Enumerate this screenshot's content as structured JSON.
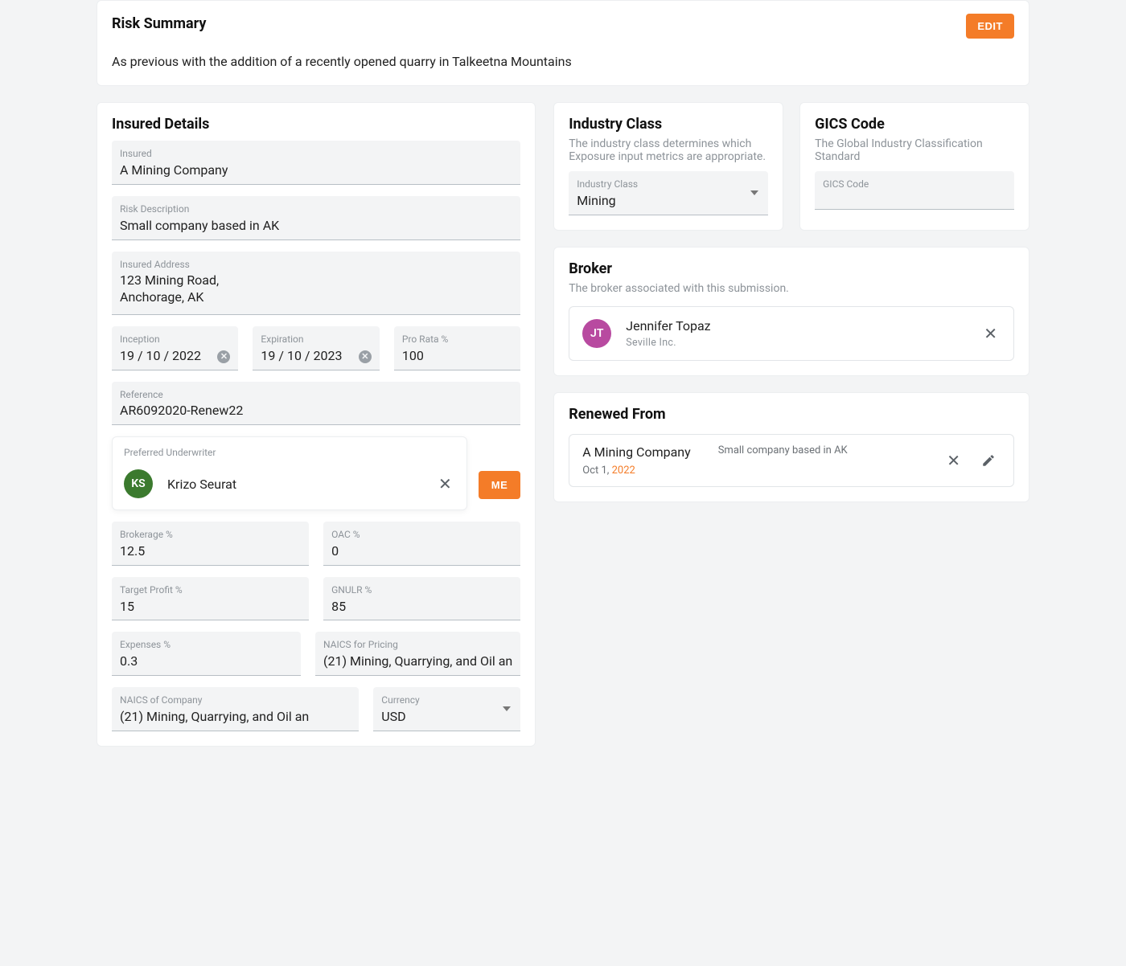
{
  "risk_summary": {
    "title": "Risk Summary",
    "edit_label": "EDIT",
    "body": "As previous with the addition of a recently opened quarry in Talkeetna Mountains"
  },
  "insured_details": {
    "title": "Insured Details",
    "insured_label": "Insured",
    "insured_value": "A Mining Company",
    "risk_desc_label": "Risk Description",
    "risk_desc_value": "Small company based in AK",
    "address_label": "Insured Address",
    "address_value": "123 Mining Road,\nAnchorage, AK",
    "inception_label": "Inception",
    "inception_value": "19 / 10 / 2022",
    "expiration_label": "Expiration",
    "expiration_value": "19 / 10 / 2023",
    "prorata_label": "Pro Rata %",
    "prorata_value": "100",
    "reference_label": "Reference",
    "reference_value": "AR6092020-Renew22",
    "underwriter_label": "Preferred Underwriter",
    "underwriter_initials": "KS",
    "underwriter_name": "Krizo Seurat",
    "me_label": "ME",
    "brokerage_label": "Brokerage %",
    "brokerage_value": "12.5",
    "oac_label": "OAC %",
    "oac_value": "0",
    "target_profit_label": "Target Profit %",
    "target_profit_value": "15",
    "gnulr_label": "GNULR %",
    "gnulr_value": "85",
    "expenses_label": "Expenses %",
    "expenses_value": "0.3",
    "naics_pricing_label": "NAICS for Pricing",
    "naics_pricing_value": "(21) Mining, Quarrying, and Oil an",
    "naics_company_label": "NAICS of Company",
    "naics_company_value": "(21) Mining, Quarrying, and Oil an",
    "currency_label": "Currency",
    "currency_value": "USD"
  },
  "industry_class": {
    "title": "Industry Class",
    "subtitle": "The industry class determines which Exposure input metrics are appropriate.",
    "field_label": "Industry Class",
    "field_value": "Mining"
  },
  "gics": {
    "title": "GICS Code",
    "subtitle": "The Global Industry Classification Standard",
    "field_label": "GICS Code"
  },
  "broker": {
    "title": "Broker",
    "subtitle": "The broker associated with this submission.",
    "initials": "JT",
    "name": "Jennifer Topaz",
    "org": "Seville  Inc."
  },
  "renewed": {
    "title": "Renewed From",
    "company": "A Mining Company",
    "date_prefix": "Oct 1, ",
    "date_year": "2022",
    "desc": "Small company based in AK"
  }
}
